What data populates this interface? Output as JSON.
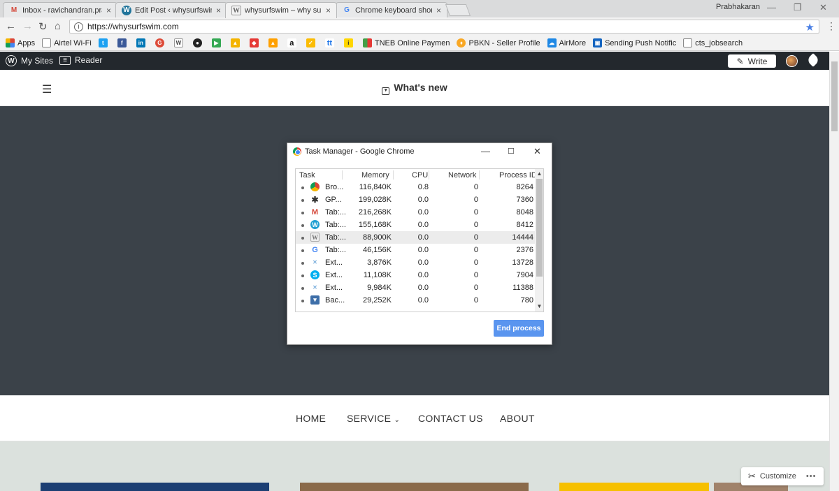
{
  "browser": {
    "tabs": [
      {
        "title": "Inbox - ravichandran.pra",
        "favicon": "gmail-icon",
        "color": "#d44638"
      },
      {
        "title": "Edit Post ‹ whysurfswim –",
        "favicon": "wordpress-icon",
        "color": "#21759b"
      },
      {
        "title": "whysurfswim – why surf",
        "favicon": "wikipedia-icon",
        "color": "#666666"
      },
      {
        "title": "Chrome keyboard shortc",
        "favicon": "google-icon",
        "color": "#4285f4"
      }
    ],
    "profile_name": "Prabhakaran",
    "url": "https://whysurfswim.com",
    "bookmarks": [
      {
        "label": "Apps"
      },
      {
        "label": "Airtel Wi-Fi"
      },
      {
        "label": "TNEB Online Paymen"
      },
      {
        "label": "PBKN - Seller Profile"
      },
      {
        "label": "AirMore"
      },
      {
        "label": "Sending Push Notific"
      },
      {
        "label": "cts_jobsearch"
      }
    ]
  },
  "wp_admin_bar": {
    "my_sites": "My Sites",
    "reader": "Reader",
    "write": "Write"
  },
  "site": {
    "whats_new": "What's new",
    "nav": [
      "HOME",
      "SERVICE",
      "CONTACT US",
      "ABOUT"
    ],
    "customize": "Customize"
  },
  "task_manager": {
    "title": "Task Manager - Google Chrome",
    "columns": [
      "Task",
      "Memory",
      "CPU",
      "Network",
      "Process ID"
    ],
    "rows": [
      {
        "task": "Bro...",
        "icon": "chrome-icon",
        "memory": "116,840K",
        "cpu": "0.8",
        "network": "0",
        "pid": "8264"
      },
      {
        "task": "GP...",
        "icon": "puzzle-icon",
        "memory": "199,028K",
        "cpu": "0.0",
        "network": "0",
        "pid": "7360"
      },
      {
        "task": "Tab:...",
        "icon": "gmail-icon",
        "memory": "216,268K",
        "cpu": "0.0",
        "network": "0",
        "pid": "8048"
      },
      {
        "task": "Tab:...",
        "icon": "wordpress-icon",
        "memory": "155,168K",
        "cpu": "0.0",
        "network": "0",
        "pid": "8412"
      },
      {
        "task": "Tab:...",
        "icon": "wikipedia-icon",
        "memory": "88,900K",
        "cpu": "0.0",
        "network": "0",
        "pid": "14444"
      },
      {
        "task": "Tab:...",
        "icon": "google-icon",
        "memory": "46,156K",
        "cpu": "0.0",
        "network": "0",
        "pid": "2376"
      },
      {
        "task": "Ext...",
        "icon": "extension-icon",
        "memory": "3,876K",
        "cpu": "0.0",
        "network": "0",
        "pid": "13728"
      },
      {
        "task": "Ext...",
        "icon": "skype-icon",
        "memory": "11,108K",
        "cpu": "0.0",
        "network": "0",
        "pid": "7904"
      },
      {
        "task": "Ext...",
        "icon": "extension-icon",
        "memory": "9,984K",
        "cpu": "0.0",
        "network": "0",
        "pid": "11388"
      },
      {
        "task": "Bac...",
        "icon": "background-page-icon",
        "memory": "29,252K",
        "cpu": "0.0",
        "network": "0",
        "pid": "780"
      }
    ],
    "end_process": "End process"
  }
}
